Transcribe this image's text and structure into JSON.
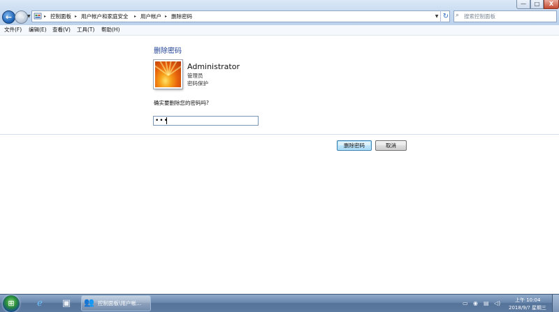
{
  "window": {
    "controls": {
      "minimize": "—",
      "maximize": "□",
      "close": "X"
    }
  },
  "address_bar": {
    "breadcrumbs": [
      "控制面板",
      "用户帐户和家庭安全",
      "用户帐户",
      "删除密码"
    ],
    "separator": "▸",
    "icon": "control-panel-icon"
  },
  "search": {
    "placeholder": "搜索控制面板"
  },
  "menu": [
    "文件(F)",
    "编辑(E)",
    "查看(V)",
    "工具(T)",
    "帮助(H)"
  ],
  "page": {
    "title": "删除密码",
    "user": {
      "name": "Administrator",
      "role": "管理员",
      "status": "密码保护",
      "picture_icon": "user-flower-picture"
    },
    "question": "确实要删除您的密码吗?",
    "password_value": "•••",
    "buttons": {
      "primary": "删除密码",
      "cancel": "取消"
    }
  },
  "taskbar": {
    "start_icon": "windows-orb",
    "pinned": [
      "internet-explorer-icon",
      "control-panel-icon"
    ],
    "active_task": {
      "label": "控制面板\\用户帐...",
      "icon": "users-icon"
    },
    "clock": {
      "time": "上午 10:04",
      "date": "2018/9/? 星期三"
    }
  },
  "colors": {
    "title_link": "#1e3f93",
    "taskbar": "#5d7aa1",
    "accent_button": "#3c7fb1"
  }
}
